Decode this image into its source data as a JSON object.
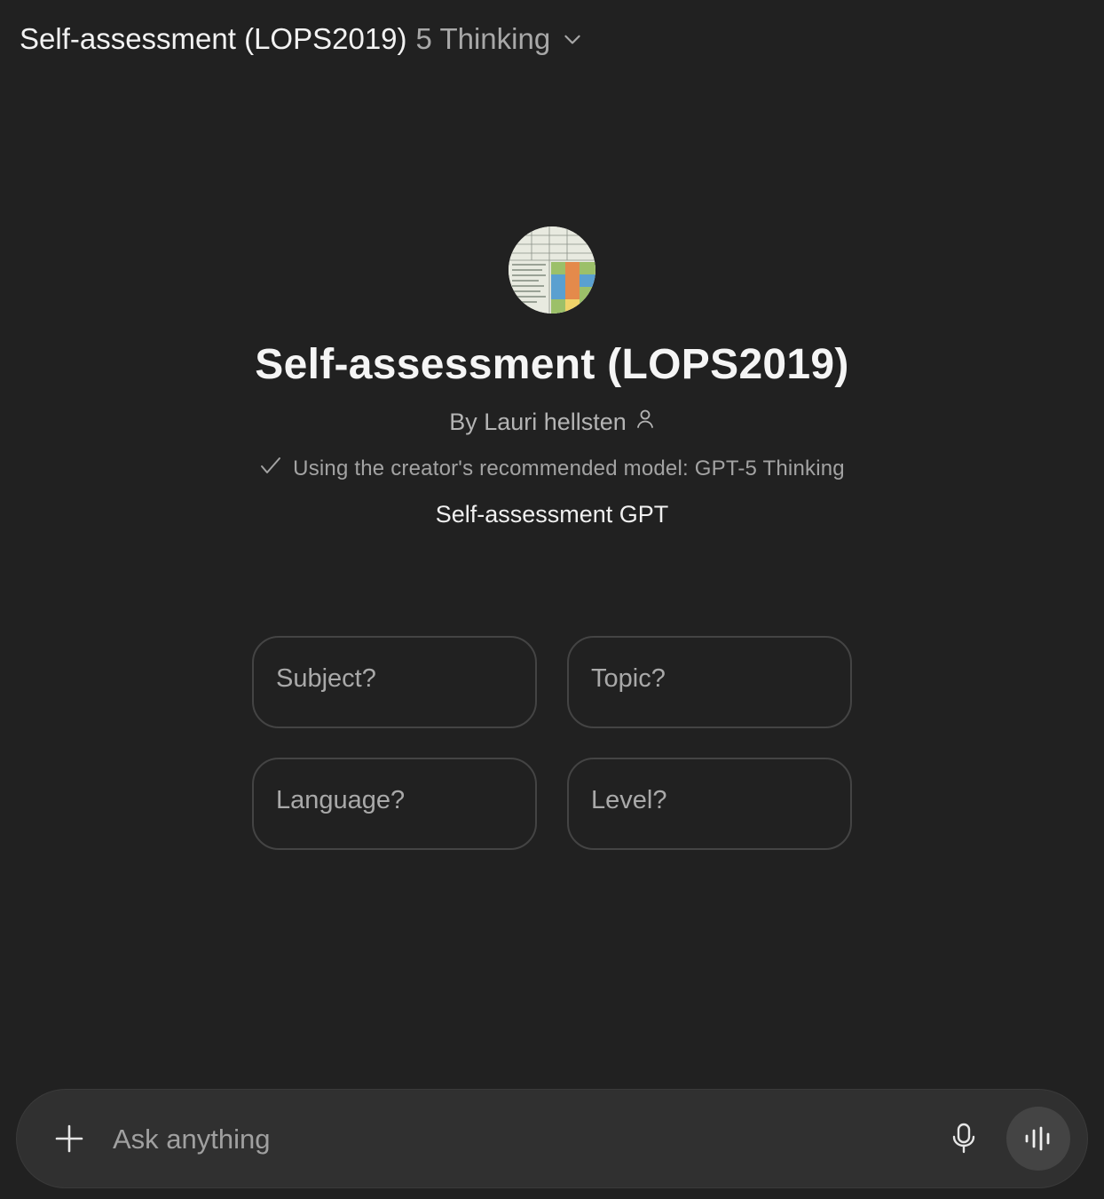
{
  "header": {
    "app_name": "Self-assessment (LOPS2019)",
    "model_name": "5 Thinking",
    "chevron_icon": "chevron-down-icon"
  },
  "hero": {
    "avatar_icon": "rubric-table-avatar",
    "title": "Self-assessment (LOPS2019)",
    "byline": "By Lauri hellsten",
    "byline_icon": "person-icon",
    "recommendation": "Using the creator's recommended model: GPT-5 Thinking",
    "recommendation_icon": "checkmark-icon",
    "description": "Self-assessment GPT"
  },
  "starters": [
    {
      "label": "Subject?"
    },
    {
      "label": "Topic?"
    },
    {
      "label": "Language?"
    },
    {
      "label": "Level?"
    }
  ],
  "composer": {
    "placeholder": "Ask anything",
    "plus_icon": "plus-icon",
    "mic_icon": "microphone-icon",
    "voice_icon": "voice-waveform-icon"
  },
  "colors": {
    "background": "#212121",
    "composer_bg": "#303030",
    "starter_border": "#444444",
    "voice_button_bg": "#444444"
  }
}
